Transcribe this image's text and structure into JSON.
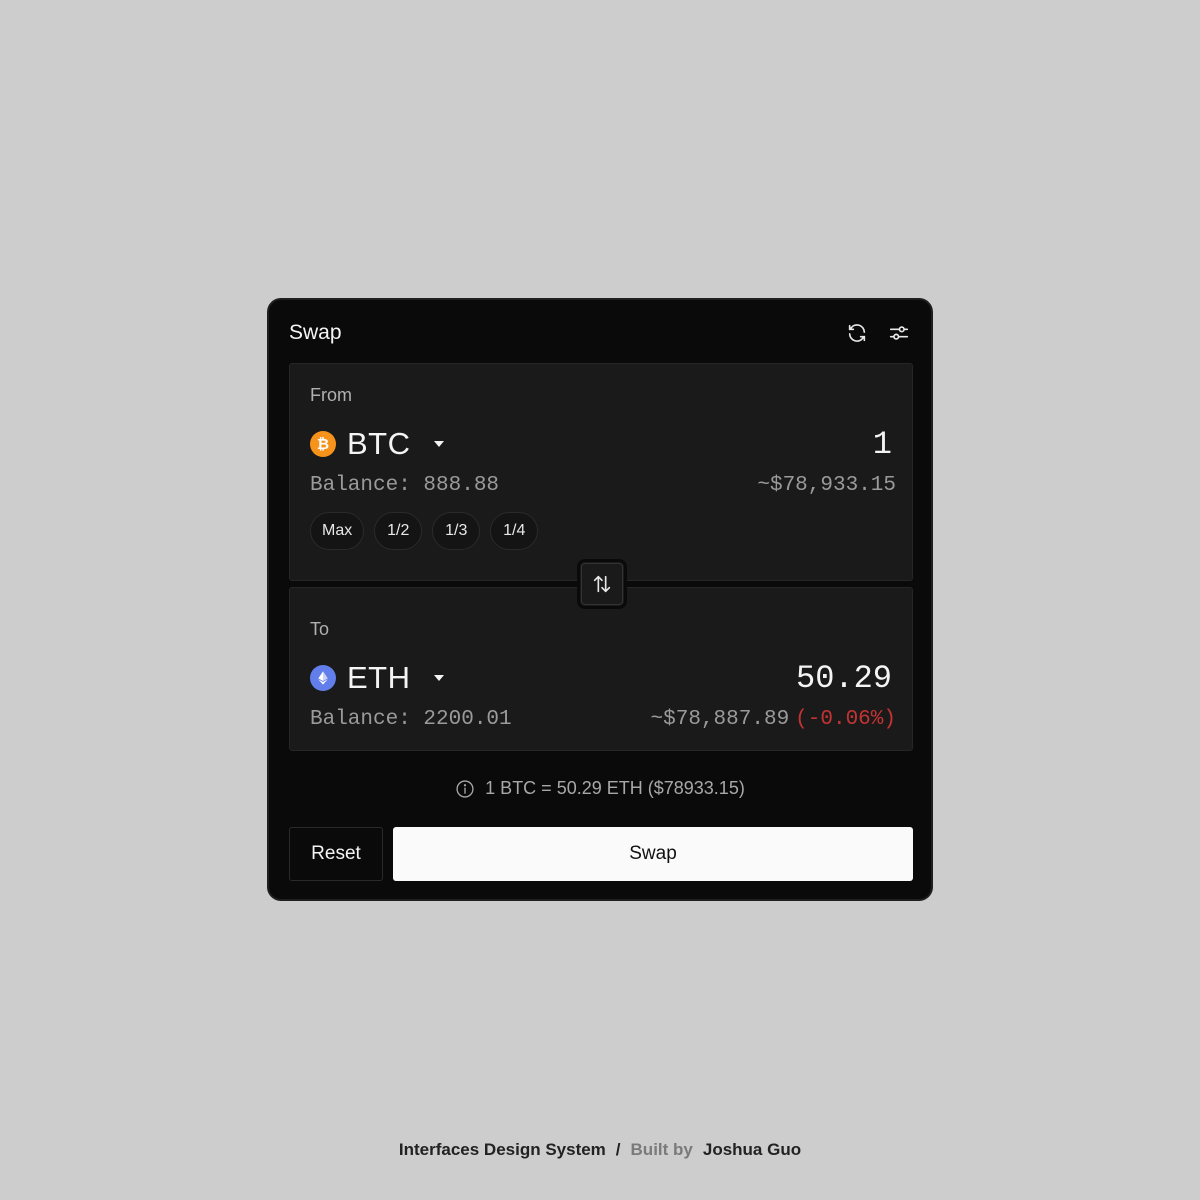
{
  "header": {
    "title": "Swap",
    "icons": [
      "refresh-icon",
      "settings-sliders-icon"
    ]
  },
  "from": {
    "label": "From",
    "token": {
      "symbol": "BTC",
      "icon": "bitcoin-icon",
      "color": "#f7931a",
      "glyph": "₿"
    },
    "amount": "1",
    "balance": "Balance: 888.88",
    "usd_value": "~$78,933.15",
    "quick_amounts": [
      "Max",
      "1/2",
      "1/3",
      "1/4"
    ]
  },
  "to": {
    "label": "To",
    "token": {
      "symbol": "ETH",
      "icon": "ethereum-icon",
      "color": "#627eea"
    },
    "amount": "50.29",
    "balance": "Balance: 2200.01",
    "usd_value": "~$78,887.89",
    "price_change": "(-0.06%)",
    "price_change_color": "#c43333"
  },
  "flip_icon": "swap-vertical-arrows-icon",
  "rate": {
    "icon": "info-icon",
    "text": "1 BTC = 50.29 ETH ($78933.15)"
  },
  "actions": {
    "reset_label": "Reset",
    "swap_label": "Swap"
  },
  "footer": {
    "brand": "Interfaces Design System",
    "separator": "/",
    "built_by_label": "Built by",
    "author": "Joshua Guo"
  }
}
